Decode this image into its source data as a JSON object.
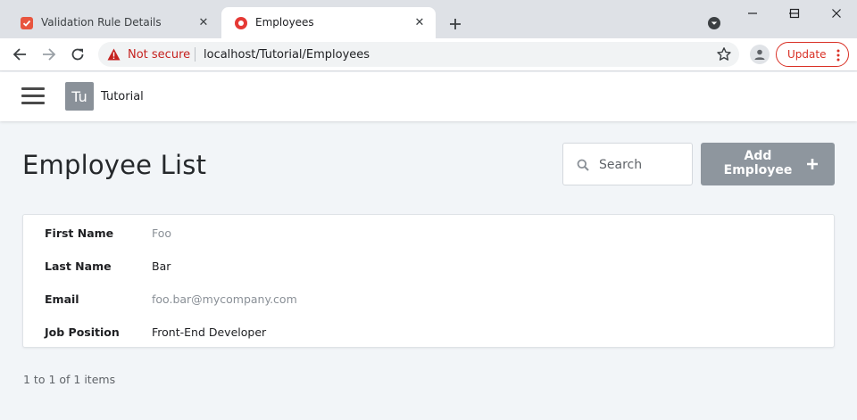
{
  "browser": {
    "tabs": [
      {
        "title": "Validation Rule Details",
        "active": false
      },
      {
        "title": "Employees",
        "active": true
      }
    ],
    "security_label": "Not secure",
    "url": "localhost/Tutorial/Employees",
    "update_label": "Update"
  },
  "app": {
    "avatar_text": "Tu",
    "name": "Tutorial"
  },
  "page": {
    "title": "Employee List",
    "search_placeholder": "Search",
    "add_button_label": "Add Employee"
  },
  "employee": {
    "fields": [
      {
        "label": "First Name",
        "value": "Foo"
      },
      {
        "label": "Last Name",
        "value": "Bar"
      },
      {
        "label": "Email",
        "value": "foo.bar@mycompany.com"
      },
      {
        "label": "Job Position",
        "value": "Front-End Developer"
      }
    ]
  },
  "pager": {
    "info": "1 to 1 of 1 items"
  },
  "colors": {
    "accent_red": "#d93025",
    "button_gray": "#8e969e",
    "page_bg": "#f2f5f8"
  }
}
